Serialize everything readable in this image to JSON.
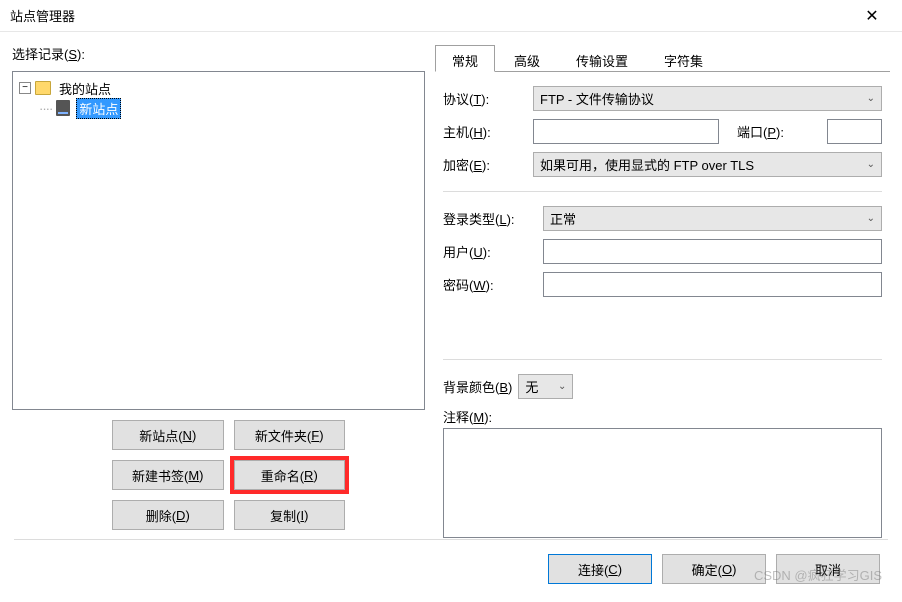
{
  "title": "站点管理器",
  "left": {
    "label_pre": "选择记录(",
    "label_u": "S",
    "label_post": "):",
    "tree": {
      "root": "我的站点",
      "item": "新站点"
    },
    "buttons": {
      "new_site_pre": "新站点(",
      "new_site_u": "N",
      "new_site_post": ")",
      "new_folder_pre": "新文件夹(",
      "new_folder_u": "F",
      "new_folder_post": ")",
      "new_bookmark_pre": "新建书签(",
      "new_bookmark_u": "M",
      "new_bookmark_post": ")",
      "rename_pre": "重命名(",
      "rename_u": "R",
      "rename_post": ")",
      "delete_pre": "删除(",
      "delete_u": "D",
      "delete_post": ")",
      "copy_pre": "复制(",
      "copy_u": "I",
      "copy_post": ")"
    }
  },
  "tabs": [
    "常规",
    "高级",
    "传输设置",
    "字符集"
  ],
  "form": {
    "protocol_label_pre": "协议(",
    "protocol_label_u": "T",
    "protocol_label_post": "):",
    "protocol_value": "FTP - 文件传输协议",
    "host_label_pre": "主机(",
    "host_label_u": "H",
    "host_label_post": "):",
    "host_value": "",
    "port_label_pre": "端口(",
    "port_label_u": "P",
    "port_label_post": "):",
    "port_value": "",
    "encryption_label_pre": "加密(",
    "encryption_label_u": "E",
    "encryption_label_post": "):",
    "encryption_value": "如果可用，使用显式的 FTP over TLS",
    "logon_label_pre": "登录类型(",
    "logon_label_u": "L",
    "logon_label_post": "):",
    "logon_value": "正常",
    "user_label_pre": "用户(",
    "user_label_u": "U",
    "user_label_post": "):",
    "user_value": "",
    "pass_label_pre": "密码(",
    "pass_label_u": "W",
    "pass_label_post": "):",
    "pass_value": "",
    "bgcolor_label_pre": "背景颜色(",
    "bgcolor_label_u": "B",
    "bgcolor_label_post": ")",
    "bgcolor_value": "无",
    "comment_label_pre": "注释(",
    "comment_label_u": "M",
    "comment_label_post": "):",
    "comment_value": ""
  },
  "footer": {
    "connect_pre": "连接(",
    "connect_u": "C",
    "connect_post": ")",
    "ok_pre": "确定(",
    "ok_u": "O",
    "ok_post": ")",
    "cancel": "取消"
  },
  "watermark": "CSDN @疯狂学习GIS"
}
